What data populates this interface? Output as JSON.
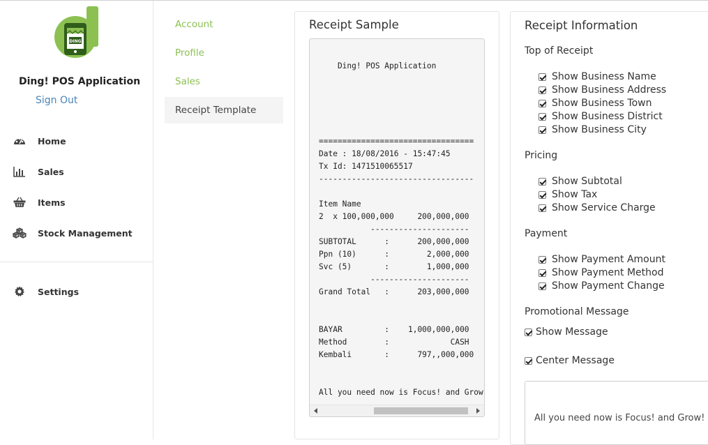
{
  "sidebar": {
    "app_name": "Ding! POS Application",
    "sign_out": "Sign Out",
    "nav": [
      {
        "label": "Home",
        "icon": "dashboard-icon"
      },
      {
        "label": "Sales",
        "icon": "bar-chart-icon"
      },
      {
        "label": "Items",
        "icon": "basket-icon"
      },
      {
        "label": "Stock Management",
        "icon": "cubes-icon"
      }
    ],
    "settings": {
      "label": "Settings",
      "icon": "gear-icon"
    }
  },
  "submenu": [
    "Account",
    "Profile",
    "Sales",
    "Receipt Template"
  ],
  "receipt_panel": {
    "title": "Receipt Sample",
    "lines": [
      "    Ding! POS Application",
      "",
      "",
      "",
      "",
      "",
      "=================================",
      "Date : 18/08/2016 - 15:47:45",
      "Tx Id: 1471510065517",
      "---------------------------------",
      "",
      "Item Name",
      "2  x 100,000,000     200,000,000",
      "           ---------------------",
      "SUBTOTAL      :      200,000,000",
      "Ppn (10)      :        2,000,000",
      "Svc (5)       :        1,000,000",
      "           ---------------------",
      "Grand Total   :      203,000,000",
      "",
      "",
      "BAYAR         :    1,000,000,000",
      "Method        :             CASH",
      "Kembali       :      797,,000,000",
      "",
      "",
      "All you need now is Focus! and Grow!"
    ]
  },
  "info_panel": {
    "title": "Receipt Information",
    "sections": {
      "top": {
        "title": "Top of Receipt",
        "items": [
          "Show Business Name",
          "Show Business Address",
          "Show Business Town",
          "Show Business District",
          "Show Business City"
        ]
      },
      "pricing": {
        "title": "Pricing",
        "items": [
          "Show Subtotal",
          "Show Tax",
          "Show Service Charge"
        ]
      },
      "payment": {
        "title": "Payment",
        "items": [
          "Show Payment Amount",
          "Show Payment Method",
          "Show Payment Change"
        ]
      },
      "promo": {
        "title": "Promotional Message",
        "show_message": "Show Message",
        "center_message": "Center Message",
        "message": "All you need now is Focus! and Grow!"
      }
    }
  },
  "colors": {
    "brand_green": "#8cc152",
    "link_blue": "#4a86b8"
  }
}
